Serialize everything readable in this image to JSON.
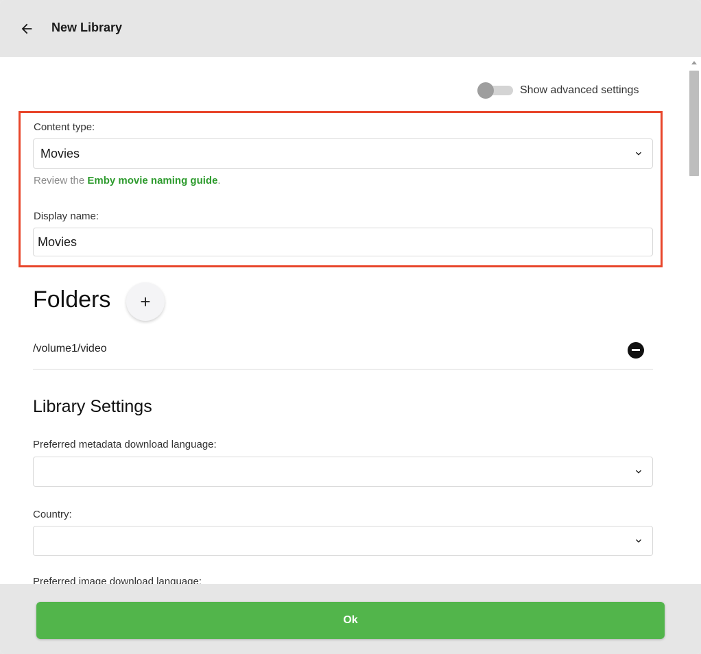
{
  "header": {
    "title": "New Library",
    "back_icon": "arrow-left-icon"
  },
  "toggle": {
    "label": "Show advanced settings",
    "checked": false
  },
  "content_type": {
    "label": "Content type:",
    "value": "Movies",
    "hint_prefix": "Review the ",
    "hint_link": "Emby movie naming guide",
    "hint_suffix": "."
  },
  "display_name": {
    "label": "Display name:",
    "value": "Movies"
  },
  "folders": {
    "title": "Folders",
    "add_label": "+",
    "items": [
      "/volume1/video"
    ]
  },
  "library_settings": {
    "title": "Library Settings",
    "metadata_language": {
      "label": "Preferred metadata download language:",
      "value": ""
    },
    "country": {
      "label": "Country:",
      "value": ""
    },
    "image_language": {
      "label": "Preferred image download language:"
    }
  },
  "footer": {
    "ok_label": "Ok"
  },
  "colors": {
    "accent": "#52b54b",
    "highlight": "#e8452a",
    "link": "#2e9b2e"
  }
}
